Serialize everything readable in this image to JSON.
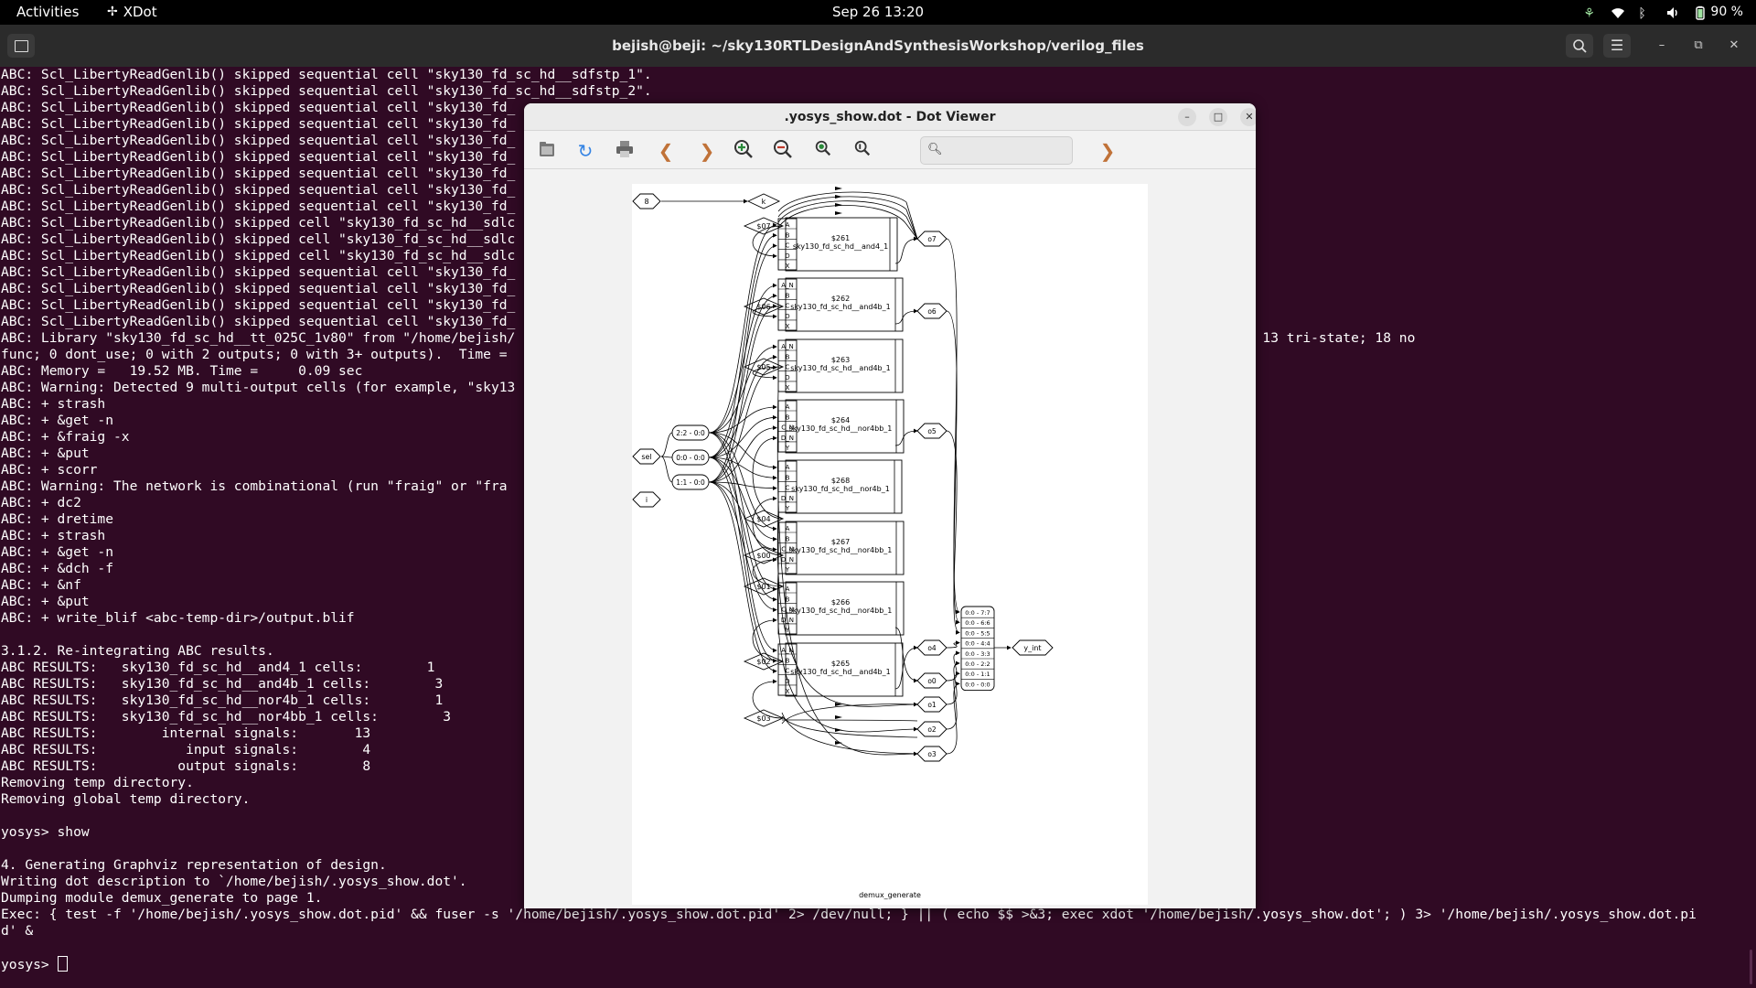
{
  "topbar": {
    "activities": "Activities",
    "app_name": "XDot",
    "clock": "Sep 26  13:20",
    "battery": "90 %"
  },
  "terminal": {
    "title": "bejish@beji: ~/sky130RTLDesignAndSynthesisWorkshop/verilog_files",
    "lines": [
      "ABC: Scl_LibertyReadGenlib() skipped sequential cell \"sky130_fd_sc_hd__sdfstp_1\".",
      "ABC: Scl_LibertyReadGenlib() skipped sequential cell \"sky130_fd_sc_hd__sdfstp_2\".",
      "ABC: Scl_LibertyReadGenlib() skipped sequential cell \"sky130_fd_",
      "ABC: Scl_LibertyReadGenlib() skipped sequential cell \"sky130_fd_",
      "ABC: Scl_LibertyReadGenlib() skipped sequential cell \"sky130_fd_",
      "ABC: Scl_LibertyReadGenlib() skipped sequential cell \"sky130_fd_",
      "ABC: Scl_LibertyReadGenlib() skipped sequential cell \"sky130_fd_",
      "ABC: Scl_LibertyReadGenlib() skipped sequential cell \"sky130_fd_",
      "ABC: Scl_LibertyReadGenlib() skipped sequential cell \"sky130_fd_",
      "ABC: Scl_LibertyReadGenlib() skipped cell \"sky130_fd_sc_hd__sdlc",
      "ABC: Scl_LibertyReadGenlib() skipped cell \"sky130_fd_sc_hd__sdlc",
      "ABC: Scl_LibertyReadGenlib() skipped cell \"sky130_fd_sc_hd__sdlc",
      "ABC: Scl_LibertyReadGenlib() skipped sequential cell \"sky130_fd_",
      "ABC: Scl_LibertyReadGenlib() skipped sequential cell \"sky130_fd_",
      "ABC: Scl_LibertyReadGenlib() skipped sequential cell \"sky130_fd_",
      "ABC: Scl_LibertyReadGenlib() skipped sequential cell \"sky130_fd_",
      "ABC: Library \"sky130_fd_sc_hd__tt_025C_1v80\" from \"/home/bejish/                                                      .b\" has 324 cells (94 skipped: 63 seq; 13 tri-state; 18 no",
      "func; 0 dont_use; 0 with 2 outputs; 0 with 3+ outputs).  Time =",
      "ABC: Memory =   19.52 MB. Time =     0.09 sec",
      "ABC: Warning: Detected 9 multi-output cells (for example, \"sky13",
      "ABC: + strash",
      "ABC: + &get -n",
      "ABC: + &fraig -x",
      "ABC: + &put",
      "ABC: + scorr",
      "ABC: Warning: The network is combinational (run \"fraig\" or \"fra",
      "ABC: + dc2",
      "ABC: + dretime",
      "ABC: + strash",
      "ABC: + &get -n",
      "ABC: + &dch -f",
      "ABC: + &nf",
      "ABC: + &put",
      "ABC: + write_blif <abc-temp-dir>/output.blif",
      "",
      "3.1.2. Re-integrating ABC results.",
      "ABC RESULTS:   sky130_fd_sc_hd__and4_1 cells:        1",
      "ABC RESULTS:   sky130_fd_sc_hd__and4b_1 cells:        3",
      "ABC RESULTS:   sky130_fd_sc_hd__nor4b_1 cells:        1",
      "ABC RESULTS:   sky130_fd_sc_hd__nor4bb_1 cells:        3",
      "ABC RESULTS:        internal signals:       13",
      "ABC RESULTS:           input signals:        4",
      "ABC RESULTS:          output signals:        8",
      "Removing temp directory.",
      "Removing global temp directory.",
      "",
      "yosys> show",
      "",
      "4. Generating Graphviz representation of design.",
      "Writing dot description to `/home/bejish/.yosys_show.dot'.",
      "Dumping module demux_generate to page 1.",
      "Exec: { test -f '/home/bejish/.yosys_show.dot.pid' && fuser -s '/home/bejish/.yosys_show.dot.pid' 2> /dev/null; } || ( echo $$ >&3; exec xdot '/home/bejish/.yosys_show.dot'; ) 3> '/home/bejish/.yosys_show.dot.pi",
      "d' &",
      "",
      "yosys> "
    ]
  },
  "dotviewer": {
    "title": ".yosys_show.dot - Dot Viewer",
    "find_placeholder": "",
    "graph": {
      "module_label": "demux_generate",
      "inputs": [
        "8",
        "sel",
        "i"
      ],
      "k_label": "k",
      "wires_left": [
        "$07",
        "$06",
        "$05",
        "$04",
        "$00",
        "$01",
        "$02",
        "$03"
      ],
      "slices_sel": [
        "2:2 - 0:0",
        "0:0 - 0:0",
        "1:1 - 0:0"
      ],
      "cells": [
        {
          "id": "$261",
          "type": "sky130_fd_sc_hd__and4_1",
          "pins": [
            "A",
            "B",
            "C",
            "D",
            "X"
          ]
        },
        {
          "id": "$262",
          "type": "sky130_fd_sc_hd__and4b_1",
          "pins": [
            "A_N",
            "B",
            "C",
            "D",
            "X"
          ]
        },
        {
          "id": "$263",
          "type": "sky130_fd_sc_hd__and4b_1",
          "pins": [
            "A_N",
            "B",
            "C",
            "D",
            "X"
          ]
        },
        {
          "id": "$264",
          "type": "sky130_fd_sc_hd__nor4bb_1",
          "pins": [
            "A",
            "B",
            "C_N",
            "D_N",
            "Y"
          ]
        },
        {
          "id": "$268",
          "type": "sky130_fd_sc_hd__nor4b_1",
          "pins": [
            "A",
            "B",
            "C",
            "D_N",
            "Y"
          ]
        },
        {
          "id": "$267",
          "type": "sky130_fd_sc_hd__nor4bb_1",
          "pins": [
            "A",
            "B",
            "C_N",
            "D_N",
            "Y"
          ]
        },
        {
          "id": "$266",
          "type": "sky130_fd_sc_hd__nor4bb_1",
          "pins": [
            "A",
            "B",
            "C_N",
            "D_N",
            "Y"
          ]
        },
        {
          "id": "$265",
          "type": "sky130_fd_sc_hd__and4b_1",
          "pins": [
            "A_N",
            "B",
            "C",
            "D",
            "X"
          ]
        }
      ],
      "outputs_right": [
        "o7",
        "o6",
        "o5",
        "o4",
        "o0",
        "o1",
        "o2",
        "o3"
      ],
      "concat_slots": [
        "0:0 - 7:7",
        "0:0 - 6:6",
        "0:0 - 5:5",
        "0:0 - 4:4",
        "0:0 - 3:3",
        "0:0 - 2:2",
        "0:0 - 1:1",
        "0:0 - 0:0"
      ],
      "output_port": "y_int"
    }
  }
}
